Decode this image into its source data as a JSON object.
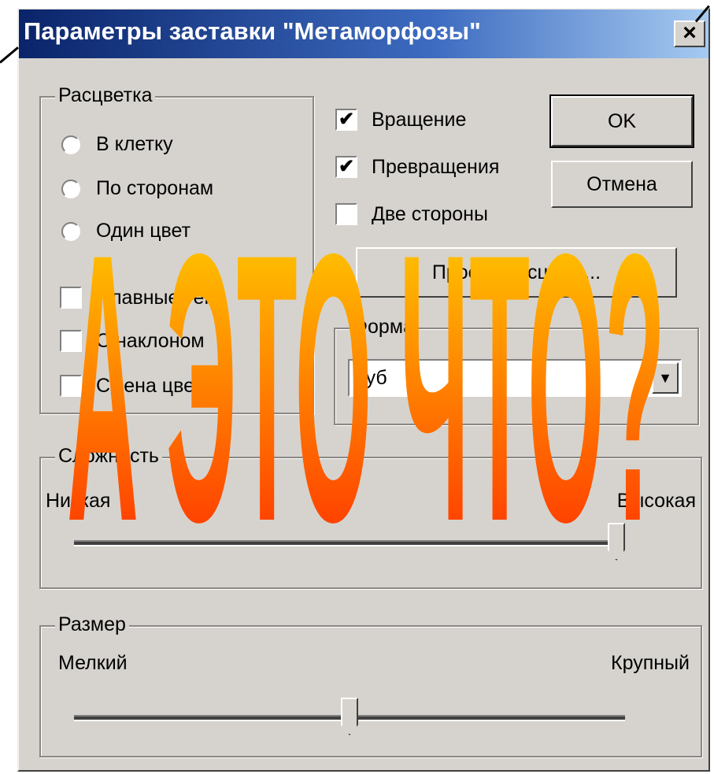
{
  "window": {
    "title": "Параметры заставки \"Метаморфозы\"",
    "close_label": "×"
  },
  "coloring": {
    "legend": "Расцветка",
    "options": [
      "В клетку",
      "По сторонам",
      "Один цвет"
    ],
    "extra_options": [
      "Плавные тени",
      "С наклоном",
      "Смена цветов"
    ]
  },
  "checkboxes": [
    {
      "label": "Вращение",
      "checked": true,
      "mark": "✔"
    },
    {
      "label": "Превращения",
      "checked": true,
      "mark": "✔"
    },
    {
      "label": "Две стороны",
      "checked": false,
      "mark": ""
    }
  ],
  "buttons": {
    "ok": "OK",
    "cancel": "Отмена",
    "preview": "Просмотр сцены..."
  },
  "shape": {
    "legend": "Форма",
    "value": "Куб"
  },
  "complexity": {
    "legend": "Сложность",
    "min_label": "Низкая",
    "max_label": "Высокая",
    "value_fraction": 1.0
  },
  "size": {
    "legend": "Размер",
    "min_label": "Мелкий",
    "max_label": "Крупный",
    "value_fraction": 0.5
  },
  "overlay": {
    "text": "А ЭТО ЧТО?",
    "gradient_top": "#ffe000",
    "gradient_bottom": "#ff2000"
  },
  "colors": {
    "dialog_bg": "#d6d3ce",
    "titlebar_start": "#0a246a",
    "titlebar_end": "#a6caf0"
  }
}
